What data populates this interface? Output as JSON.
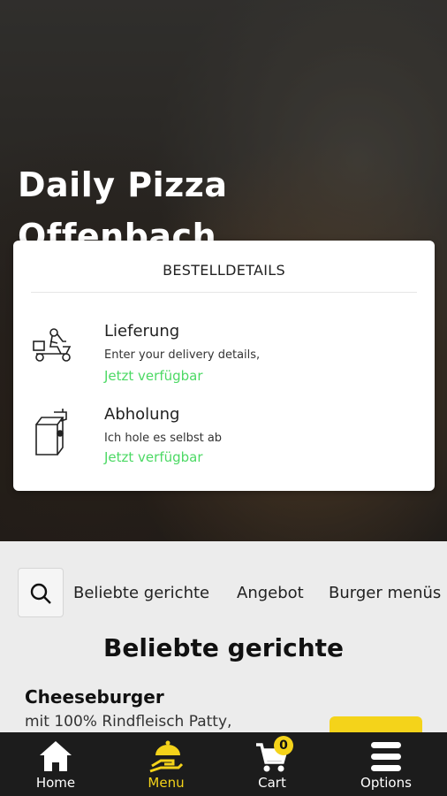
{
  "hero": {
    "title": "Daily Pizza Offenbach"
  },
  "modal": {
    "title": "BESTELLDETAILS",
    "options": [
      {
        "title": "Lieferung",
        "description": "Enter your delivery details,",
        "status": "Jetzt verfügbar",
        "icon": "delivery-scooter-icon"
      },
      {
        "title": "Abholung",
        "description": "Ich hole es selbst ab",
        "status": "Jetzt verfügbar",
        "icon": "takeaway-bag-icon"
      }
    ]
  },
  "categories": {
    "search_icon": "search-icon",
    "items": [
      "Beliebte gerichte",
      "Angebot",
      "Burger menüs"
    ]
  },
  "section": {
    "title": "Beliebte gerichte"
  },
  "dish": {
    "name": "Cheeseburger",
    "description": "mit 100% Rindfleisch Patty,"
  },
  "nav": {
    "items": [
      {
        "label": "Home",
        "icon": "home-icon"
      },
      {
        "label": "Menu",
        "icon": "menu-cloche-icon"
      },
      {
        "label": "Cart",
        "icon": "cart-icon",
        "badge": "0"
      },
      {
        "label": "Options",
        "icon": "options-icon"
      }
    ]
  },
  "colors": {
    "accent": "#f4d31a",
    "available": "#4cd964",
    "nav_bg": "#1c1c1c"
  }
}
